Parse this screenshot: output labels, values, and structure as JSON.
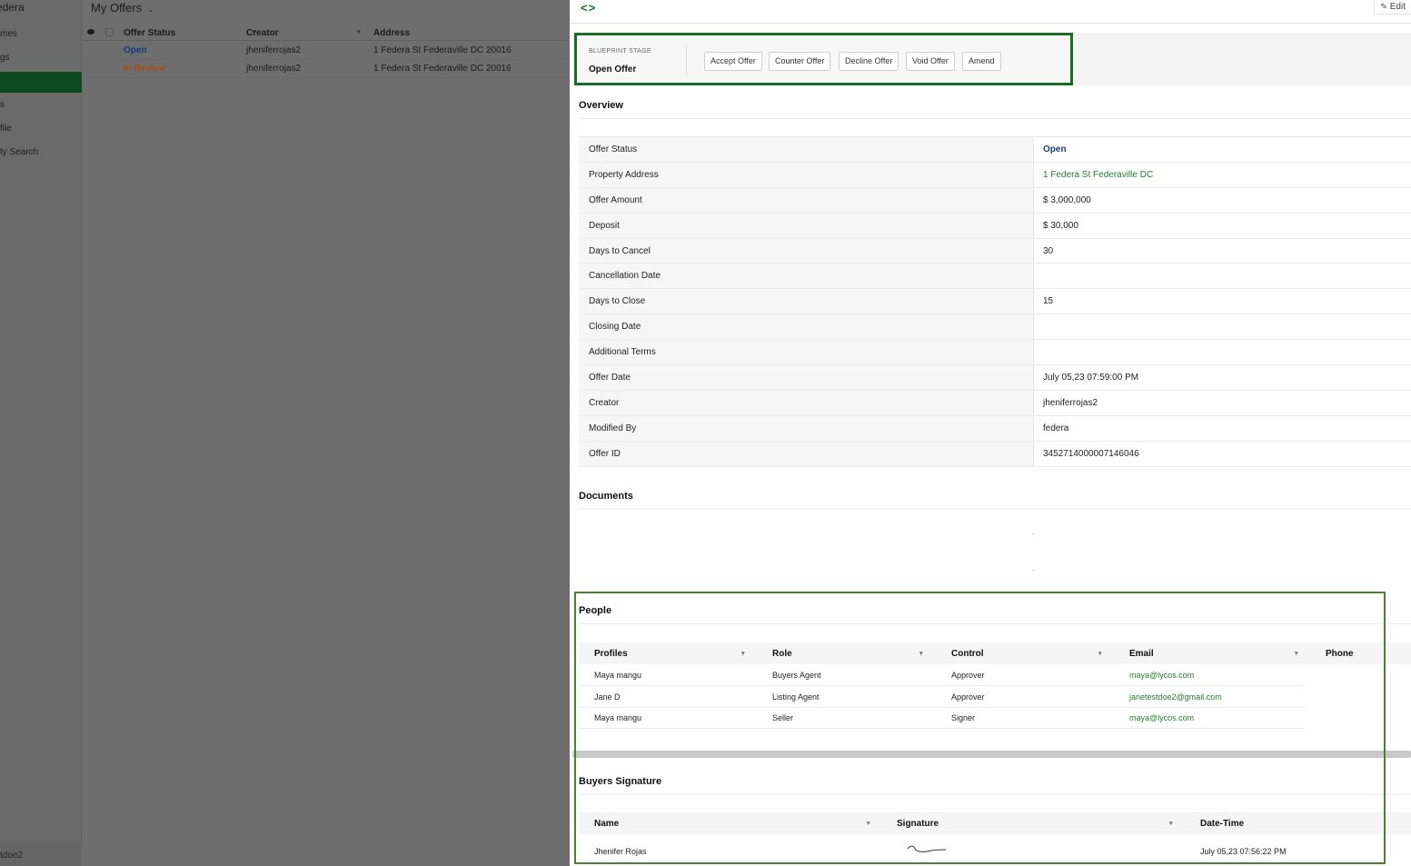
{
  "sidebar": {
    "brand": "edera",
    "items": [
      {
        "label": "mes"
      },
      {
        "label": "gs"
      },
      {
        "label": ""
      },
      {
        "label": "s"
      },
      {
        "label": "file"
      },
      {
        "label": "ty Search"
      }
    ],
    "user": "tdoe2"
  },
  "list": {
    "title": "My Offers",
    "columns": {
      "status": "Offer Status",
      "creator": "Creator",
      "address": "Address"
    },
    "rows": [
      {
        "status": "Open",
        "creator": "jheniferrojas2",
        "address": "1 Federa St Federaville DC 20016"
      },
      {
        "status": "In Review",
        "creator": "jheniferrojas2",
        "address": "1 Federa St Federaville DC 20016"
      }
    ]
  },
  "detail": {
    "edit_label": "Edit",
    "blueprint": {
      "label": "BLUEPRINT STAGE",
      "value": "Open Offer",
      "buttons": [
        "Accept Offer",
        "Counter Offer",
        "Decline Offer",
        "Void Offer",
        "Amend"
      ]
    },
    "overview": {
      "title": "Overview",
      "rows": [
        {
          "key": "Offer Status",
          "value": "Open"
        },
        {
          "key": "Property Address",
          "value": "1 Federa St Federaville DC"
        },
        {
          "key": "Offer Amount",
          "value": "$ 3,000,000"
        },
        {
          "key": "Deposit",
          "value": "$ 30,000"
        },
        {
          "key": "Days to Cancel",
          "value": "30"
        },
        {
          "key": "Cancellation Date",
          "value": ""
        },
        {
          "key": "Days to Close",
          "value": "15"
        },
        {
          "key": "Closing Date",
          "value": ""
        },
        {
          "key": "Additional Terms",
          "value": ""
        },
        {
          "key": "Offer Date",
          "value": "July 05,23 07:59:00 PM"
        },
        {
          "key": "Creator",
          "value": "jheniferrojas2"
        },
        {
          "key": "Modified By",
          "value": "federa"
        },
        {
          "key": "Offer ID",
          "value": "3452714000007146046"
        }
      ]
    },
    "documents": {
      "title": "Documents",
      "empty_marks": [
        "-",
        "-"
      ]
    },
    "people": {
      "title": "People",
      "columns": {
        "profiles": "Profiles",
        "role": "Role",
        "control": "Control",
        "email": "Email",
        "phone": "Phone"
      },
      "rows": [
        {
          "profile": "Maya mangu",
          "role": "Buyers Agent",
          "control": "Approver",
          "email": "maya@lycos.com"
        },
        {
          "profile": "Jane D",
          "role": "Listing Agent",
          "control": "Approver",
          "email": "janetestdoe2@gmail.com"
        },
        {
          "profile": "Maya mangu",
          "role": "Seller",
          "control": "Signer",
          "email": "maya@lycos.com"
        }
      ]
    },
    "buyers_signature": {
      "title": "Buyers Signature",
      "columns": {
        "name": "Name",
        "signature": "Signature",
        "datetime": "Date-Time"
      },
      "rows": [
        {
          "name": "Jhenifer Rojas",
          "datetime": "July 05,23 07:56:22 PM"
        }
      ]
    }
  },
  "colors": {
    "brand_green": "#1a6a2a",
    "open_blue": "#17427f",
    "review_orange": "#a34a12",
    "link_green": "#2a7a2f"
  }
}
